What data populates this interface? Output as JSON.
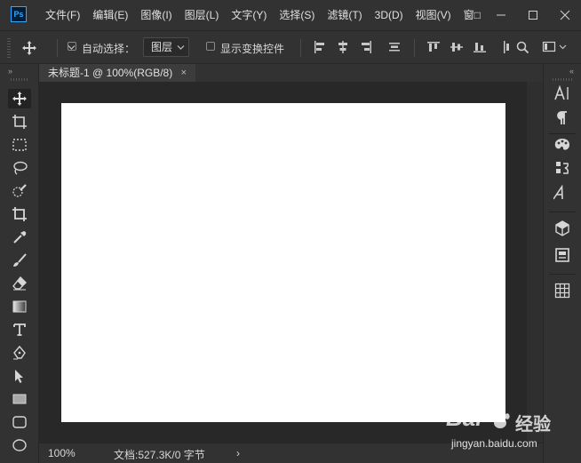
{
  "app": {
    "logo_text": "Ps"
  },
  "menu": [
    "文件(F)",
    "编辑(E)",
    "图像(I)",
    "图层(L)",
    "文字(Y)",
    "选择(S)",
    "滤镜(T)",
    "3D(D)",
    "视图(V)",
    "窗□"
  ],
  "options": {
    "auto_select_label": "自动选择：",
    "auto_select_target": "图层",
    "show_transform_label": "显示变换控件"
  },
  "document": {
    "tab_title": "未标题-1 @ 100%(RGB/8)",
    "close_glyph": "×"
  },
  "status": {
    "zoom": "100%",
    "doc_info": "文档:527.3K/0 字节",
    "more_glyph": "›"
  },
  "left_tools": [
    "move-tool",
    "artboard-tool",
    "marquee-tool",
    "lasso-tool",
    "quick-select-tool",
    "crop-tool",
    "eyedropper-tool",
    "brush-tool",
    "eraser-tool",
    "gradient-tool",
    "type-tool",
    "pen-tool",
    "path-select-tool",
    "rectangle-tool",
    "rounded-rect-tool",
    "ellipse-tool"
  ],
  "right_panels": [
    "character-panel",
    "paragraph-panel",
    "color-swatch-panel",
    "history-panel",
    "glyphs-panel",
    "3d-panel",
    "properties-panel",
    "grid-panel"
  ],
  "watermark": {
    "brand": "Bai",
    "brand2": "经验",
    "url": "jingyan.baidu.com"
  },
  "colors": {
    "bg": "#323232",
    "pasteboard": "#282828",
    "canvas": "#ffffff",
    "accent": "#31a8ff"
  }
}
